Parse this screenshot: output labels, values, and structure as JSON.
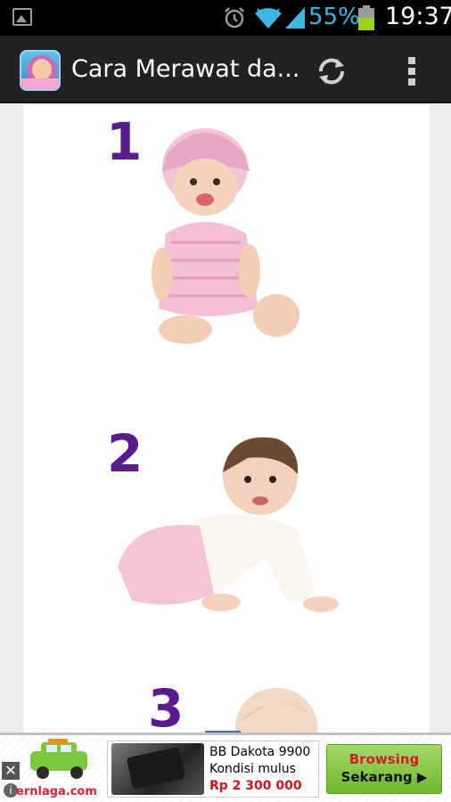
{
  "status_bar": {
    "battery_percent": "55%",
    "time": "19:37",
    "icons": [
      "image-notification-icon",
      "alarm-icon",
      "wifi-icon",
      "signal-icon",
      "battery-icon"
    ],
    "battery_color": "#3db7e4"
  },
  "action_bar": {
    "title": "Cara Merawat da...",
    "actions": [
      "refresh-icon",
      "overflow-menu-icon"
    ]
  },
  "content": {
    "items": [
      {
        "number": "1"
      },
      {
        "number": "2"
      },
      {
        "number": "3"
      }
    ],
    "number_color": "#5a1b8c"
  },
  "ad": {
    "brand": "ernlaga.com",
    "title": "BB Dakota 9900",
    "subtitle": "Kondisi mulus",
    "price": "Rp 2 300 000",
    "cta_line1": "Browsing",
    "cta_line2": "Sekarang ▶",
    "close_label": "✕",
    "info_label": "i"
  }
}
